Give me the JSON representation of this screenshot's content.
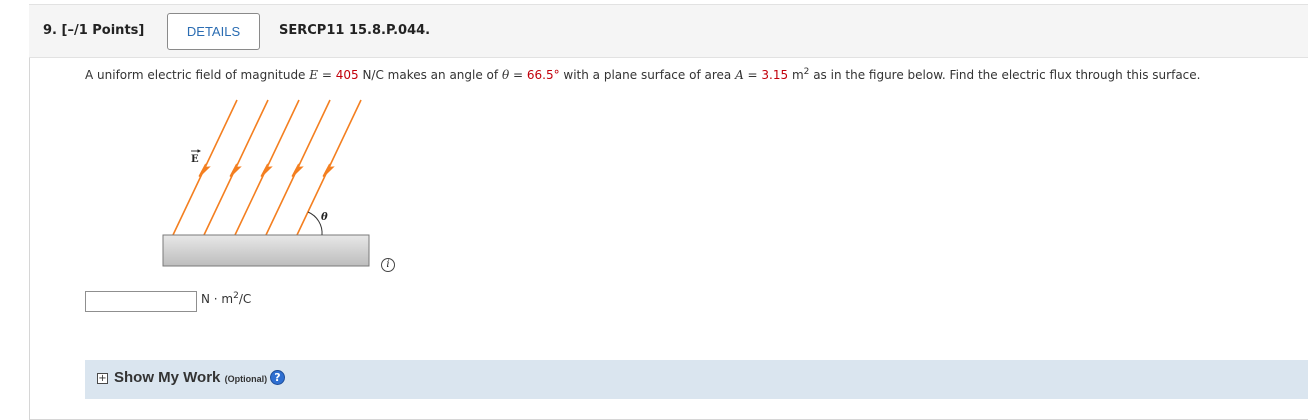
{
  "header": {
    "question_number": "9. [–/1 Points]",
    "details_label": "DETAILS",
    "problem_code": "SERCP11 15.8.P.044."
  },
  "prompt": {
    "part1": "A uniform electric field of magnitude ",
    "E_symbol": "E",
    "equals1": " = ",
    "E_value": "405",
    "part2": " N/C makes an angle of ",
    "theta_symbol": "θ",
    "equals2": " = ",
    "theta_value": "66.5°",
    "part3": " with a plane surface of area ",
    "A_symbol": "A",
    "equals3": " = ",
    "A_value": "3.15",
    "area_unit": " m",
    "area_exp": "2",
    "part4": " as in the figure below. Find the electric flux through this surface."
  },
  "figure": {
    "field_label": "E",
    "angle_label": "θ",
    "field_line_color": "#f47f20",
    "slab_color": "#cfcfcf"
  },
  "info_icon": "i",
  "answer": {
    "value": "",
    "unit_base": "N · m",
    "unit_exp": "2",
    "unit_tail": "/C"
  },
  "show_work": {
    "toggle_icon": "plus-box-icon",
    "toggle_symbol": "+",
    "label": "Show My Work",
    "optional": "(Optional)",
    "help_symbol": "?"
  },
  "colors": {
    "accent_blue": "#2a6cb2",
    "given_value_red": "#c2000b",
    "work_bar_bg": "#dae5ef"
  }
}
